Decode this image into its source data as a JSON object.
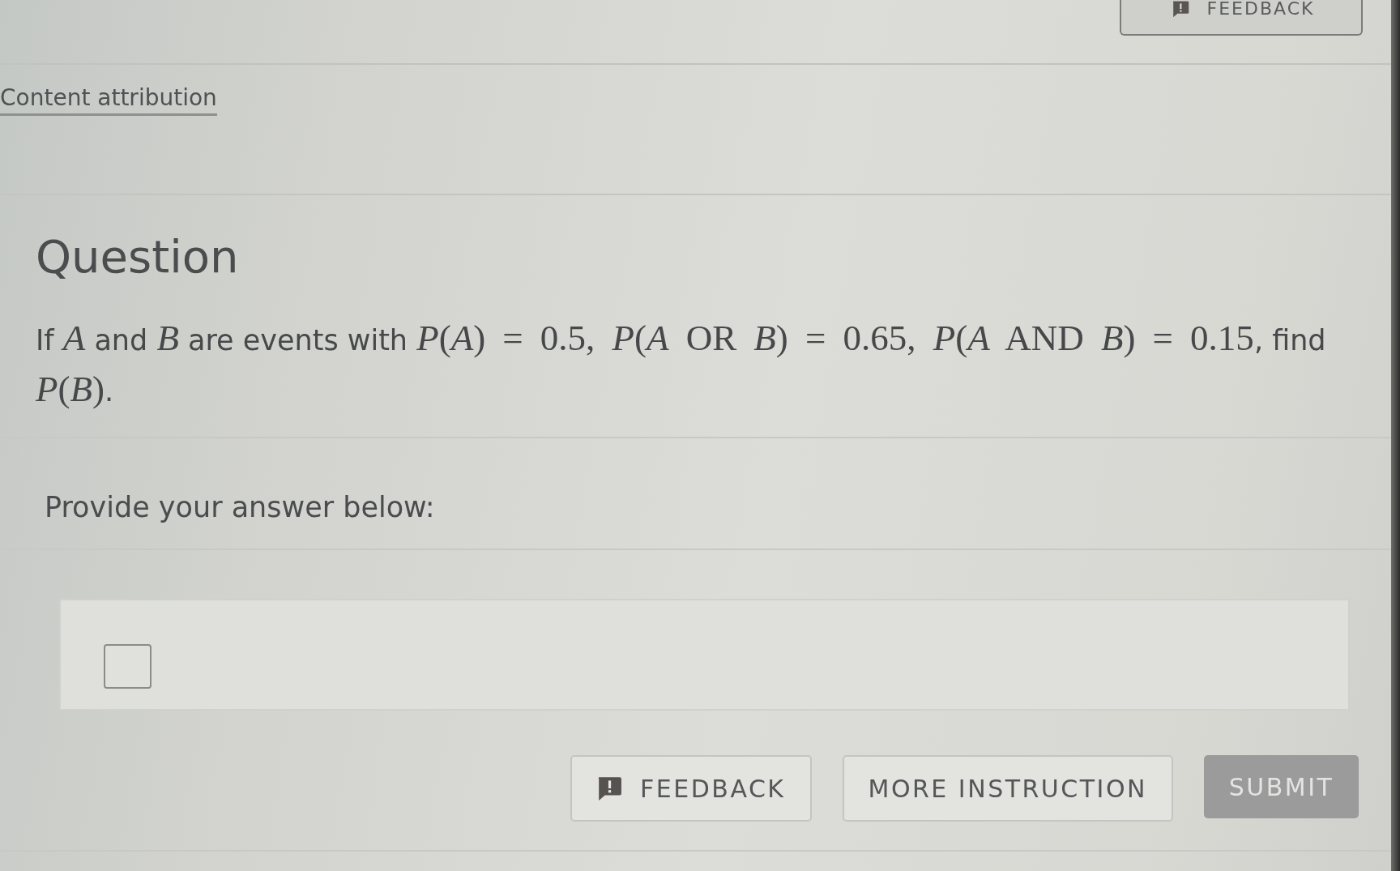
{
  "top_bar": {
    "feedback_button": {
      "label": "FEEDBACK"
    }
  },
  "attribution": {
    "link": "Content attribution"
  },
  "question": {
    "title": "Question",
    "text": [
      {
        "kind": "text",
        "text": "If "
      },
      {
        "kind": "math",
        "text": "*A*"
      },
      {
        "kind": "text",
        "text": " and "
      },
      {
        "kind": "math",
        "text": "*B*"
      },
      {
        "kind": "text",
        "text": " are events with "
      },
      {
        "kind": "math",
        "text": "*P*(*A*) = 0.5, "
      },
      {
        "kind": "math",
        "text": "*P*(*A* OR *B*) = 0.65, "
      },
      {
        "kind": "math",
        "text": "*P*(*A* AND *B*) = 0.15"
      },
      {
        "kind": "text",
        "text": ", find "
      },
      {
        "kind": "math",
        "text": "*P*(*B*)"
      },
      {
        "kind": "text",
        "text": "."
      }
    ]
  },
  "answer": {
    "prompt": "Provide your answer below:"
  },
  "buttons": [
    {
      "kind": "feedback",
      "label": "FEEDBACK",
      "disabled": false
    },
    {
      "kind": "secondary",
      "label": "MORE INSTRUCTION",
      "disabled": false
    },
    {
      "kind": "primary",
      "label": "SUBMIT",
      "disabled": true
    }
  ]
}
